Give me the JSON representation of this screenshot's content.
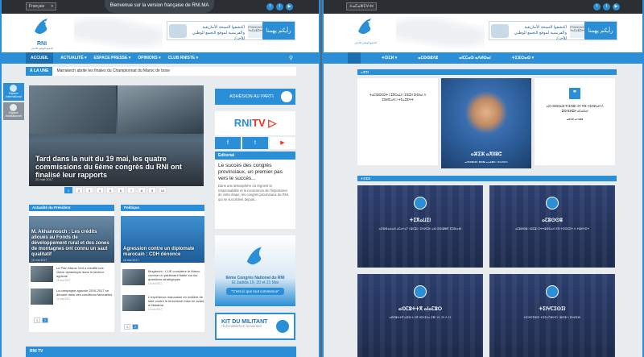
{
  "colors": {
    "accent": "#2a8fd6",
    "dark": "#2b2f33",
    "youtube": "#e32222"
  },
  "left": {
    "topbar": {
      "language": "Français",
      "banner": "Bienvenue sur la version française de RNI.MA",
      "social": [
        "f",
        "t",
        "▶"
      ]
    },
    "logo": {
      "text": "RNI",
      "sub": "التجمع الوطني للأحرار"
    },
    "ad": {
      "arabic": "اكتشفوا النسخة الأمازيغية والفرنسية لموقع التجمع الوطني للأحرار",
      "badge": "FRANÇAIS ⵜⴰⵎⴰⵣⵉⵖⵜ",
      "cta": "رأيكم يهمنا"
    },
    "nav": [
      "ACCUEIL",
      "ACTUALITÉ ▾",
      "ESPACE PRESSE ▾",
      "OPINIONS ▾",
      "CLUB RNISTE ▾"
    ],
    "ticker": {
      "label": "À LA UNE",
      "text": "Marrakech abrite les finales du Championnat du Maroc de boxe"
    },
    "sidetabs": [
      "Espace International",
      "Espace Institutionnel"
    ],
    "hero": {
      "caption": "Tard dans la nuit du 19 mai, les quatre commissions du 6ème congrès du RNI ont finalisé leur rapports",
      "date": "20 mai 2017"
    },
    "pager": [
      "1",
      "2",
      "3",
      "4",
      "5",
      "6",
      "7",
      "8",
      "9",
      "10"
    ],
    "president": {
      "header": "Actualité du Président",
      "feature": {
        "caption": "M. Akhannouch : Les crédits alloués au Fonds de développement rural et des zones de montagnes ont connu un saut qualitatif",
        "date": "16 mai 2017"
      },
      "items": [
        {
          "text": "Le Plan Maroc Vert a insufflé une vision dynamique dans le secteur agricole",
          "date": "15 mai 2017"
        },
        {
          "text": "La campagne agricole 2016-2017 se déroule dans des conditions favorables",
          "date": "11 mai 2017"
        }
      ],
      "pager": [
        "1",
        "2"
      ]
    },
    "politique": {
      "header": "Politique",
      "feature": {
        "caption": "Agression contre un diplomate marocain : CDH dénonce",
        "date": "16 mai 2017"
      },
      "items": [
        {
          "text": "Mogherini : L'UE considère le Maroc comme un partenaire fiable sur les questions stratégiques",
          "date": "15 mai 2017"
        },
        {
          "text": "L'expérience marocaine en matière de lutte contre le terrorisme mise en avant à Manama",
          "date": "12 mai 2017"
        }
      ],
      "pager": [
        "1",
        "2"
      ]
    },
    "right": {
      "adhesion": "ADHÉSION AU PARTI",
      "rnitv": "RNI",
      "rnitv_tv": "TV",
      "social": [
        "f",
        "t",
        "▶"
      ],
      "editorial": {
        "header": "Editorial",
        "title": "Le succès des congrès provinciaux, un premier pas vers le succès...",
        "body": "Dans une atmosphère où règnent la responsabilité et la conscience de l'importance de cette étape, les congrès provinciaux du RNI, qui se succèdent depuis..."
      },
      "congres": {
        "title": "6ème Congrès National du RNI",
        "place": "El Jadida 19, 20 et 21 Mai",
        "slogan": "\"C'est ici que tout commence\""
      },
      "kit": {
        "title": "KIT DU MILITANT",
        "sub": "TÉLÉCHARGER KIT DU MILITANT"
      }
    },
    "footer": "RNI TV"
  },
  "rightpane": {
    "language": "ⵜⴰⵎⴰⵣⵉⵖⵜ",
    "social": [
      "f",
      "t",
      "▶"
    ],
    "nav": [
      "ⵜⵉⵏⵎⵍ ▾",
      "ⴰⵎⵙⵙⵓⴷⵓ",
      "ⴰⵏⵎⵎⴰⵙ ⴰⴷⵍⵙⴰⵏ",
      "ⵜⵉⴼⵔⴰⵙ ▾"
    ],
    "section1": "ⴰⵏⵎⵓⵏ",
    "quote1": "ⵜⴰⵎⵙⵙⵉⵔⵜ ⵏ ⵓⴳⵔⴰⵡ ⵏ ⵉⵏⵎⵓⵏⵏ ⵉⵍⵍⴰⵏ ⴷ ⵉⵙⵍⵎⴰⴷⵏ ⵏ ⵜⵎⴰⵣⵉⵖⵜ",
    "portrait": {
      "name": "ⴰⵣⵉⵣ ⴰⵅⵏⵏⵓⵛ",
      "role": "ⴰⵏⵙⵙⵓⴷⵓ ⵏ ⵓⵏⵎⵓⵏ ⴰⵏⴰⵎⵓⵔ ⵏ ⵉⵍⵍⵉⵍⵏ"
    },
    "quote2": "ⴰⵔ ⵏⵙⵙⵉⵡⵍ ⴳ ⵓⵏⵎⵓⵏ ⵏⵏⵖ ⵅⴼ ⵜⵉⵍⵍⴰⵍ ⴷ ⵓⵙⵏⴼⵍⵓⵍ ⴰⵎⴰⵡⴰⵏ",
    "quote2_author": "ⴰⵣⵉⵣ ⴰⵅⵏⵏⵓⵛ",
    "section2": "ⵜⵉⵏⵎⵍ",
    "tiles": [
      {
        "title": "ⵜⵉⴳⴰⵡⵉⵏ",
        "body": "ⴰⵎⵙⵙⴰⵡⴰⵍ ⴰⵎⴰⵜⴰⵢ ⵏ ⵓⵏⵎⵓⵏ ⵏ ⵉⵍⵍⵉⵍⵏ ⴰⵔ ⵉⵙⵏⵓⴱⴳ ⵉⵎⵙⵏⴰⵍⵏ"
      },
      {
        "title": "ⴰⵎⵓⵙⵙⵓ",
        "body": "ⴰⵎⵓⵙⵙⵓ ⵏ ⵓⵏⵎⵓⵏ ⵉⵜⵜⵓⵙⵎⴰⵍ ⵅⴼ ⵜⵉⵔⵎⵉⵜ ⴷ ⵜⵓⵍⵖⵉⵜ"
      },
      {
        "title": "ⴰⵙⵎⵓⵜⵜⴳ ⴰⵏⴰⵎⵓⵔ",
        "body": "ⴰⵙⵎⵓⵜⵜⴳ ⵡⵉⵙ 6 ⴷⴳ ⵍⵊⴷⵉⴷⴰ ⵉⴹⵏ 19, 20 ⴷ 21"
      },
      {
        "title": "ⵜⵉⵏⵖⵎⵉⵙⵉⵏ",
        "body": "ⵜⵉⵏⵖⵎⵉⵙⵉⵏ ⵜⵉⵎⴰⵢⵏⵓⵜⵉⵏ ⵏ ⵓⵏⵎⵓⵏ ⵏ ⵉⵍⵍⵉⵍⵏ"
      }
    ]
  }
}
